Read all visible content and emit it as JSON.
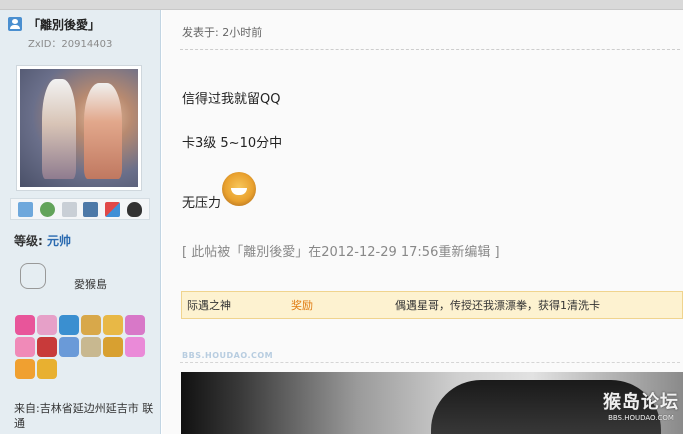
{
  "user": {
    "name": "「離別後愛」",
    "zxid": "ZxID：20914403",
    "level_label": "等级:",
    "level_value": "元帅",
    "home_label": "愛猴島",
    "location": "来自:吉林省延边州延吉市 联通"
  },
  "post": {
    "meta": "发表于: 2小时前",
    "lines": [
      "信得过我就留QQ",
      "卡3级 5~10分中",
      "无压力"
    ],
    "edit_note": "[ 此帖被「離別後愛」在2012-12-29 17:56重新编辑 ]"
  },
  "reward": {
    "user": "际遇之神",
    "label": "奖励",
    "desc": "偶遇星哥，传授还我漂漂拳，获得1清洗卡"
  },
  "watermark": "BBS.HOUDAO.COM",
  "logo": {
    "name": "猴岛论坛",
    "url": "BBS.HOUDAO.COM"
  },
  "icons": [
    "pm-icon",
    "add-friend-icon",
    "search-posts-icon",
    "profile-icon",
    "blocks-icon",
    "qq-icon"
  ],
  "medal_colors": [
    "#e8559a",
    "#e6a0c8",
    "#3a8fd0",
    "#d8a84a",
    "#e8b846",
    "#d878c8",
    "#f08ab8",
    "#c83a3a",
    "#6a9ad8",
    "#c8b890",
    "#d8a030",
    "#ea8ad8",
    "#f0a030",
    "#e8b030"
  ],
  "colors": {
    "sidebar_bg": "#e5edf2",
    "reward_bg": "#fdf2d0",
    "reward_accent": "#e07a10",
    "level_color": "#2a6ab0"
  }
}
